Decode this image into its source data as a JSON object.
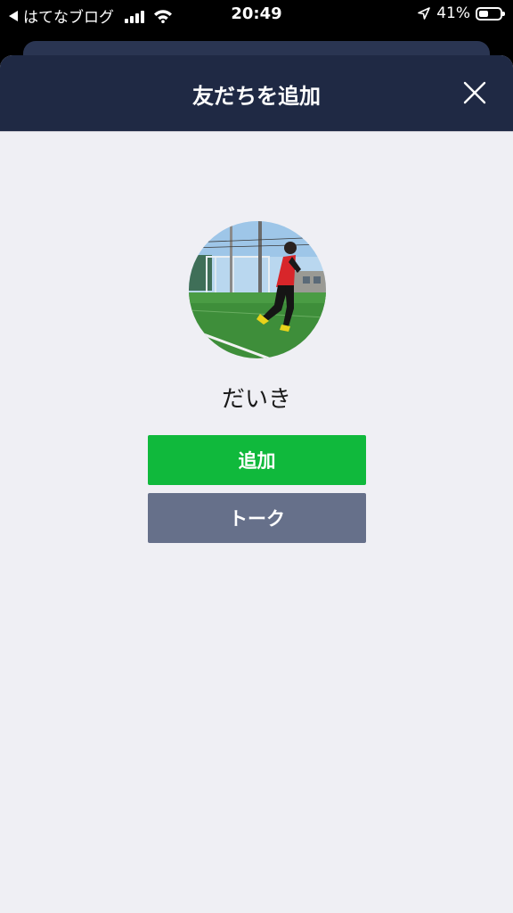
{
  "status_bar": {
    "back_app": "はてなブログ",
    "time": "20:49",
    "battery": "41%"
  },
  "header": {
    "title": "友だちを追加"
  },
  "profile": {
    "name": "だいき"
  },
  "buttons": {
    "add_label": "追加",
    "talk_label": "トーク"
  },
  "colors": {
    "header_bg": "#1f2944",
    "add_button": "#10b93c",
    "talk_button": "#66708a",
    "page_bg": "#efeff4"
  },
  "icons": {
    "close": "close-icon",
    "back": "back-arrow-icon",
    "signal": "cellular-signal-icon",
    "wifi": "wifi-icon",
    "location": "location-arrow-icon",
    "battery": "battery-icon"
  }
}
